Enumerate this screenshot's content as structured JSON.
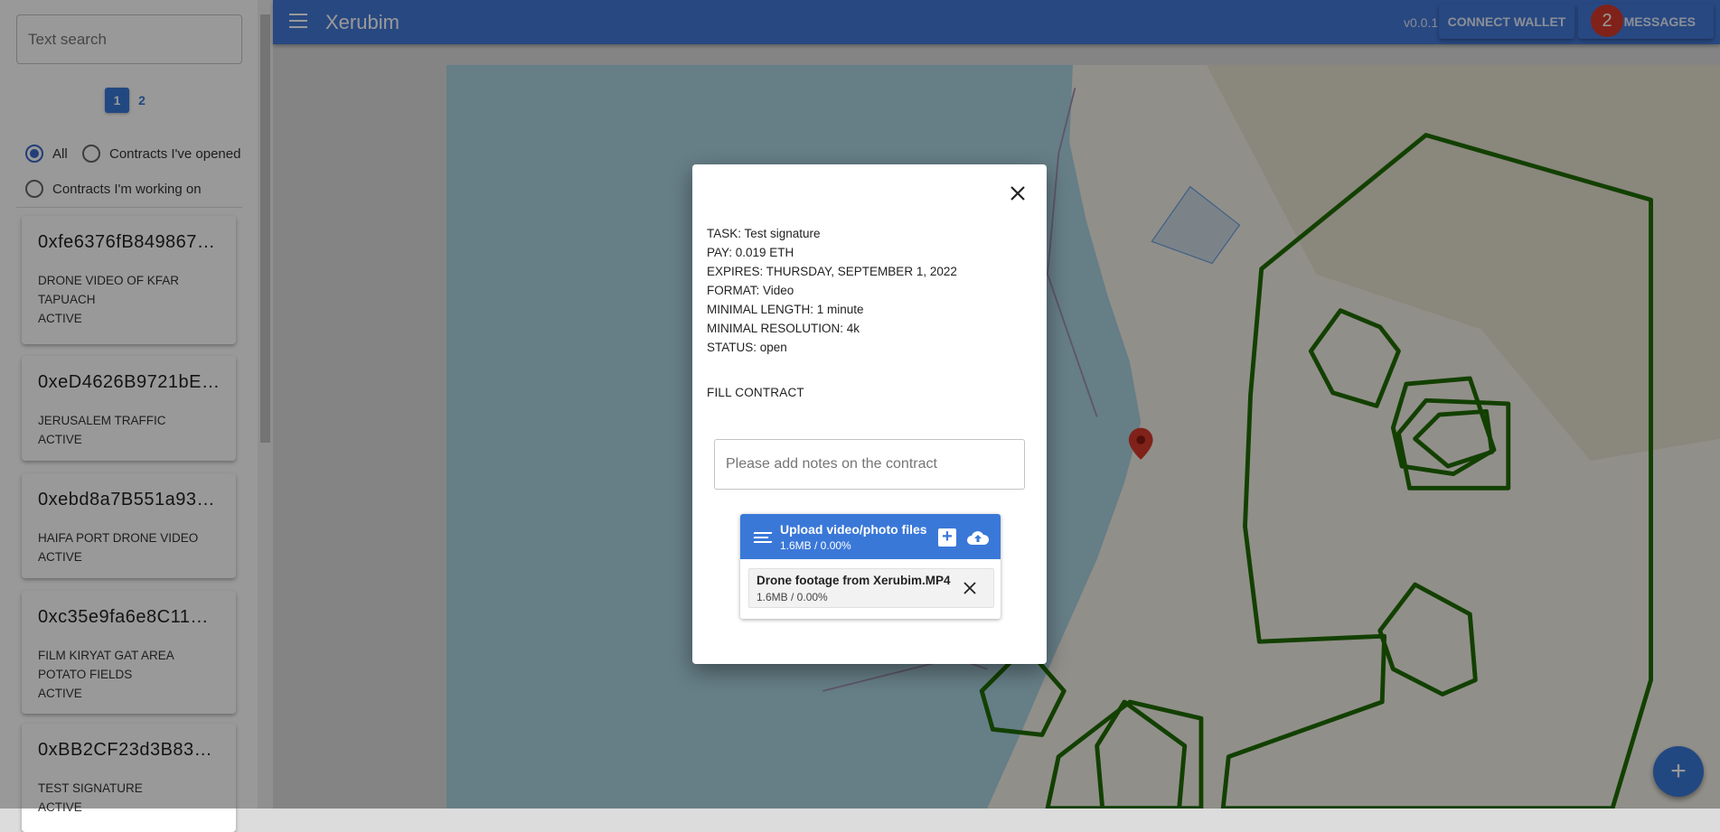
{
  "sidebar": {
    "search_placeholder": "Text search",
    "pagination": [
      "1",
      "2"
    ],
    "current_page": "1",
    "filters": [
      {
        "label": "All",
        "selected": true
      },
      {
        "label": "Contracts I've opened",
        "selected": false
      },
      {
        "label": "Contracts I'm working on",
        "selected": false
      }
    ],
    "contracts": [
      {
        "id": "0xfe6376fB849867…",
        "lines": [
          "DRONE VIDEO OF KFAR",
          "TAPUACH"
        ],
        "status": "ACTIVE"
      },
      {
        "id": "0xeD4626B9721bEb…",
        "lines": [
          "JERUSALEM TRAFFIC"
        ],
        "status": "ACTIVE"
      },
      {
        "id": "0xebd8a7B551a93c…",
        "lines": [
          "HAIFA PORT DRONE VIDEO"
        ],
        "status": "ACTIVE"
      },
      {
        "id": "0xc35e9fa6e8C11B…",
        "lines": [
          "FILM KIRYAT GAT AREA",
          "POTATO FIELDS"
        ],
        "status": "ACTIVE"
      },
      {
        "id": "0xBB2CF23d3B83a…",
        "lines": [
          "TEST SIGNATURE"
        ],
        "status": "ACTIVE"
      }
    ]
  },
  "header": {
    "title": "Xerubim",
    "version": "v0.0.1",
    "connect_wallet": "CONNECT WALLET",
    "messages": "MESSAGES",
    "messages_count": "2",
    "color": "#4479d8"
  },
  "dialog": {
    "info": [
      "TASK: Test signature",
      "PAY: 0.019 ETH",
      "EXPIRES: THURSDAY, SEPTEMBER 1, 2022",
      "FORMAT: Video",
      "MINIMAL LENGTH: 1 minute",
      "MINIMAL RESOLUTION: 4k",
      "STATUS: open"
    ],
    "fill_contract": "FILL CONTRACT",
    "notes_placeholder": "Please add notes on the contract",
    "uploader": {
      "title": "Upload video/photo files",
      "size": "1.6MB / 0.00%",
      "file": {
        "name": "Drone footage from Xerubim.MP4",
        "size": "1.6MB / 0.00%"
      }
    }
  },
  "fab": {
    "label": "+"
  },
  "colors": {
    "accent": "#3a78d8",
    "zones": "#1f6b00",
    "marker": "#d63a2a",
    "badge": "#d63a2a"
  }
}
